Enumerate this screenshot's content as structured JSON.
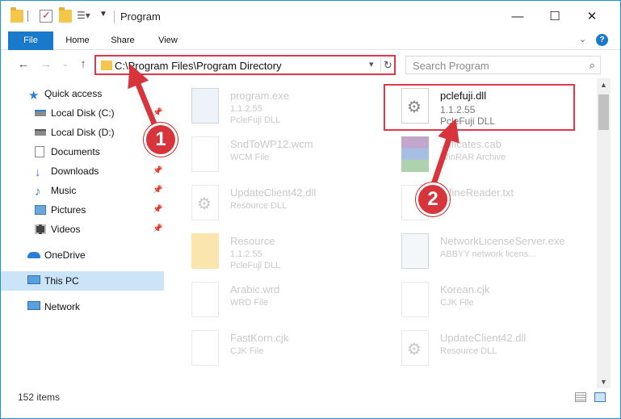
{
  "window": {
    "title": "Program",
    "controls": {
      "minimize": "—",
      "maximize": "☐",
      "close": "✕"
    }
  },
  "ribbon": {
    "tabs": [
      {
        "label": "File"
      },
      {
        "label": "Home"
      },
      {
        "label": "Share"
      },
      {
        "label": "View"
      }
    ],
    "help": "?"
  },
  "navigation": {
    "back": "←",
    "forward": "→",
    "up": "↑",
    "dropdown": "⌄",
    "address": "C:\\Program Files\\Program Directory",
    "refresh": "↻",
    "search_placeholder": "Search Program"
  },
  "sidebar": {
    "items": [
      {
        "label": "Quick access",
        "icon": "star-icon"
      },
      {
        "label": "Local Disk (C:)",
        "icon": "drive-icon"
      },
      {
        "label": "Local Disk (D:)",
        "icon": "drive-icon"
      },
      {
        "label": "Documents",
        "icon": "documents-icon"
      },
      {
        "label": "Downloads",
        "icon": "download-icon"
      },
      {
        "label": "Music",
        "icon": "music-icon"
      },
      {
        "label": "Pictures",
        "icon": "pictures-icon"
      },
      {
        "label": "Videos",
        "icon": "videos-icon"
      },
      {
        "label": "OneDrive",
        "icon": "cloud-icon"
      },
      {
        "label": "This PC",
        "icon": "computer-icon"
      },
      {
        "label": "Network",
        "icon": "network-icon"
      }
    ],
    "pin": "📌"
  },
  "files": [
    {
      "name": "program.exe",
      "meta1": "1.1.2.55",
      "meta2": "PcleFuji DLL"
    },
    {
      "name": "pclefuji.dll",
      "meta1": "1.1.2.55",
      "meta2": "PcleFuji DLL"
    },
    {
      "name": "SndToWP12.wcm",
      "meta1": "WCM File",
      "meta2": ""
    },
    {
      "name": "...ificates.cab",
      "meta1": "WinRAR Archive",
      "meta2": ""
    },
    {
      "name": "UpdateClient42.dll",
      "meta1": "Resource DLL",
      "meta2": ""
    },
    {
      "name": "...fineReader.txt",
      "meta1": "",
      "meta2": ""
    },
    {
      "name": "Resource",
      "meta1": "1.1.2.55",
      "meta2": "PcleFuji DLL"
    },
    {
      "name": "NetworkLicenseServer.exe",
      "meta1": "ABBYY network licens...",
      "meta2": ""
    },
    {
      "name": "Arabic.wrd",
      "meta1": "WRD File",
      "meta2": ""
    },
    {
      "name": "Korean.cjk",
      "meta1": "CJK File",
      "meta2": ""
    },
    {
      "name": "FastKorn.cjk",
      "meta1": "CJK File",
      "meta2": ""
    },
    {
      "name": "UpdateClient42.dll",
      "meta1": "Resource DLL",
      "meta2": ""
    }
  ],
  "annotations": {
    "step1": "1",
    "step2": "2",
    "color": "#d8343c"
  },
  "status": {
    "count": "152 items"
  }
}
